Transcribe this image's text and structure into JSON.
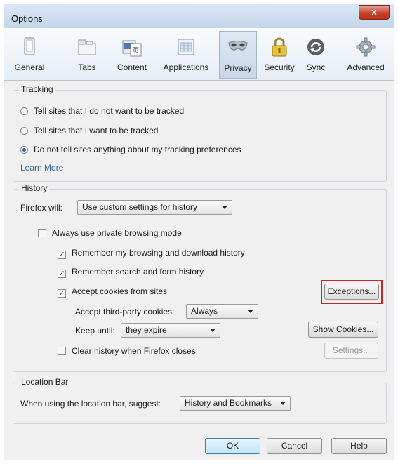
{
  "window": {
    "title": "Options",
    "close_glyph": "x"
  },
  "tabs": [
    {
      "label": "General",
      "icon": "general-window-icon"
    },
    {
      "label": "Tabs",
      "icon": "tabs-icon"
    },
    {
      "label": "Content",
      "icon": "content-icon"
    },
    {
      "label": "Applications",
      "icon": "applications-icon"
    },
    {
      "label": "Privacy",
      "icon": "privacy-mask-icon",
      "selected": true
    },
    {
      "label": "Security",
      "icon": "padlock-icon"
    },
    {
      "label": "Sync",
      "icon": "sync-icon"
    },
    {
      "label": "Advanced",
      "icon": "gear-icon"
    }
  ],
  "tracking": {
    "title": "Tracking",
    "options": [
      {
        "label": "Tell sites that I do not want to be tracked",
        "selected": false
      },
      {
        "label": "Tell sites that I want to be tracked",
        "selected": false
      },
      {
        "label": "Do not tell sites anything about my tracking preferences",
        "selected": true
      }
    ],
    "learn_more": "Learn More"
  },
  "history": {
    "title": "History",
    "firefox_will_label": "Firefox will:",
    "firefox_will_value": "Use custom settings for history",
    "private_mode": {
      "label": "Always use private browsing mode",
      "checked": false
    },
    "remember_browsing": {
      "label": "Remember my browsing and download history",
      "checked": true
    },
    "remember_search": {
      "label": "Remember search and form history",
      "checked": true
    },
    "accept_cookies": {
      "label": "Accept cookies from sites",
      "checked": true
    },
    "exceptions_button": "Exceptions...",
    "third_party_label": "Accept third-party cookies:",
    "third_party_value": "Always",
    "keep_until_label": "Keep until:",
    "keep_until_value": "they expire",
    "show_cookies_button": "Show Cookies...",
    "clear_history": {
      "label": "Clear history when Firefox closes",
      "checked": false
    },
    "settings_button": "Settings..."
  },
  "location_bar": {
    "title": "Location Bar",
    "suggest_label": "When using the location bar, suggest:",
    "suggest_value": "History and Bookmarks"
  },
  "footer": {
    "ok": "OK",
    "cancel": "Cancel",
    "help": "Help"
  },
  "colors": {
    "highlight": "#d2232a",
    "link": "#2a64b4",
    "selected_tab": "#c9d7ea"
  }
}
